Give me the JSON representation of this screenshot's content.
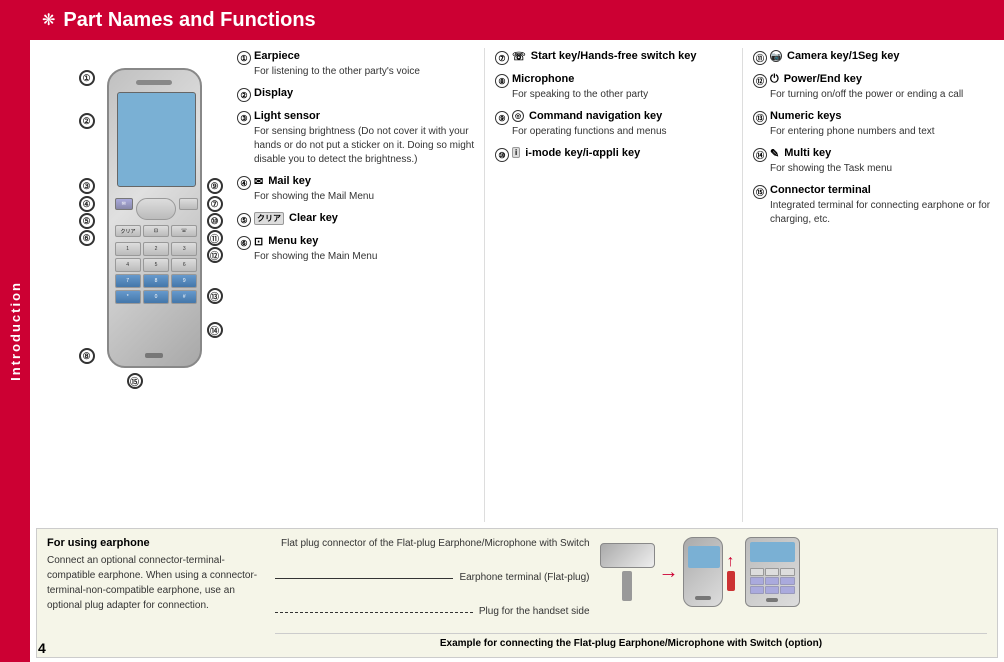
{
  "sidebar": {
    "label": "Introduction"
  },
  "header": {
    "title": "Part Names and Functions",
    "icon": "❋"
  },
  "page_number": "4",
  "descriptions": {
    "col1": [
      {
        "num": "①",
        "title": "Earpiece",
        "body": "For listening to the other party's voice"
      },
      {
        "num": "②",
        "title": "Display",
        "body": ""
      },
      {
        "num": "③",
        "title": "Light sensor",
        "body": "For sensing brightness (Do not cover it with your hands or do not put a sticker on it. Doing so might disable you to detect the brightness.)"
      },
      {
        "num": "④",
        "title": "Mail key",
        "body": "For showing the Mail Menu"
      },
      {
        "num": "⑤",
        "title": "Clear key",
        "body": ""
      },
      {
        "num": "⑥",
        "title": "Menu key",
        "body": "For showing the Main Menu"
      }
    ],
    "col2": [
      {
        "num": "⑦",
        "title": "Start key/Hands-free switch key",
        "body": ""
      },
      {
        "num": "⑧",
        "title": "Microphone",
        "body": "For speaking to the other party"
      },
      {
        "num": "⑨",
        "title": "Command navigation key",
        "body": "For operating functions and menus"
      },
      {
        "num": "⑩",
        "title": "i-mode key/i-αppli key",
        "body": ""
      }
    ],
    "col3": [
      {
        "num": "⑪",
        "title": "Camera key/1Seg key",
        "body": ""
      },
      {
        "num": "⑫",
        "title": "Power/End key",
        "body": "For turning on/off the power or ending a call"
      },
      {
        "num": "⑬",
        "title": "Numeric keys",
        "body": "For entering phone numbers and text"
      },
      {
        "num": "⑭",
        "title": "Multi key",
        "body": "For showing the Task menu"
      },
      {
        "num": "⑮",
        "title": "Connector terminal",
        "body": "Integrated terminal for connecting earphone or for charging, etc."
      }
    ]
  },
  "bottom": {
    "title": "For using earphone",
    "body": "Connect an optional connector-terminal-compatible earphone. When using a connector-terminal-non-compatible earphone, use an optional plug adapter for connection.",
    "labels": [
      "Flat plug connector of the Flat-plug Earphone/Microphone with Switch",
      "Earphone terminal (Flat-plug)",
      "Plug for the handset side"
    ],
    "caption": "Example for connecting the Flat-plug Earphone/Microphone with Switch (option)"
  }
}
